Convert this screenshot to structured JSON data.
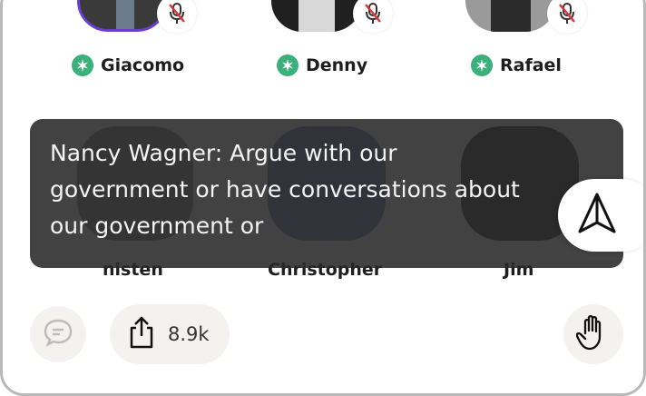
{
  "speakers": [
    {
      "name": "Giacomo",
      "muted": true,
      "moderator": true
    },
    {
      "name": "Denny",
      "muted": true,
      "moderator": true
    },
    {
      "name": "Rafael",
      "muted": true,
      "moderator": true
    }
  ],
  "listeners": [
    {
      "name": "nisten"
    },
    {
      "name": "Christopher"
    },
    {
      "name": "Jim"
    }
  ],
  "caption": {
    "text": "Nancy Wagner: Argue with our government or have conversations about our government or"
  },
  "bottom_bar": {
    "share_count": "8.9k"
  },
  "colors": {
    "moderator_green": "#3bb07b",
    "mute_red": "#d9363e",
    "caption_bg": "#282828"
  }
}
